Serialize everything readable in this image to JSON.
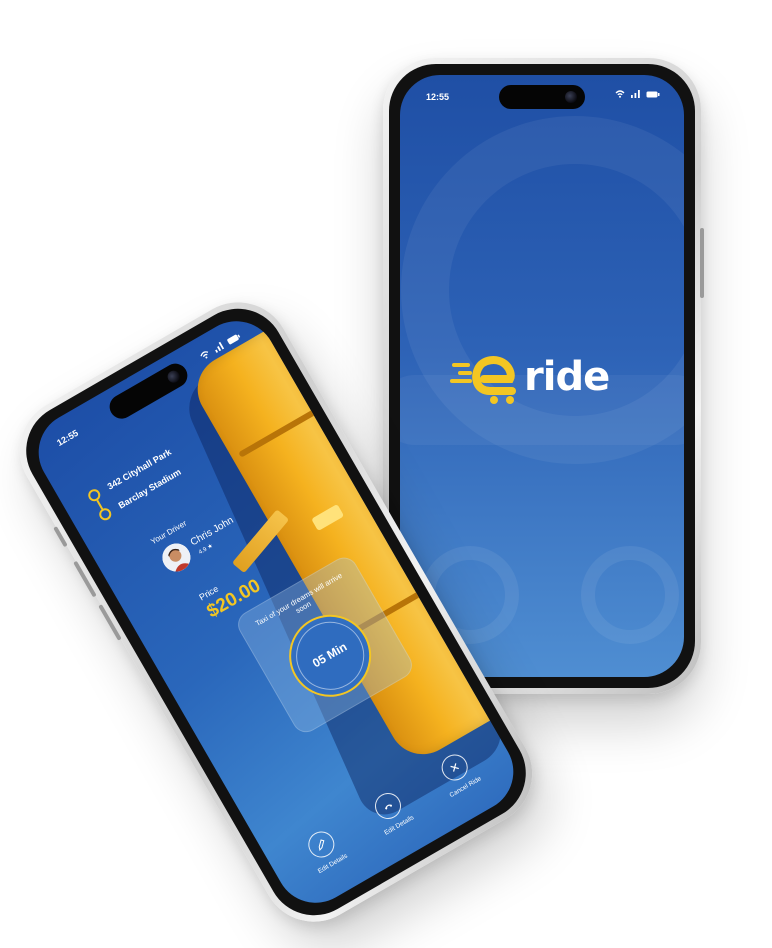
{
  "splash": {
    "status_time": "12:55",
    "logo": {
      "letter": "e",
      "word": "ride",
      "accent_color": "#F3C623"
    }
  },
  "ride": {
    "status_time": "12:55",
    "route": {
      "pickup": "342 Cityhall Park",
      "dropoff": "Barclay Stadium"
    },
    "driver": {
      "label": "Your Driver",
      "name": "Chris John",
      "rating": "4.9 ★"
    },
    "price": {
      "label": "Price",
      "value": "$20.00"
    },
    "eta": {
      "message": "Taxi of your dreams will arrive soon",
      "minutes": "05 Min"
    },
    "actions": [
      {
        "label": "Edit Details",
        "icon": "edit-icon"
      },
      {
        "label": "Edit Details",
        "icon": "phone-icon"
      },
      {
        "label": "Cancel Ride",
        "icon": "close-icon"
      }
    ]
  },
  "colors": {
    "primary_blue": "#1F4FA5",
    "accent_yellow": "#F3C623"
  }
}
